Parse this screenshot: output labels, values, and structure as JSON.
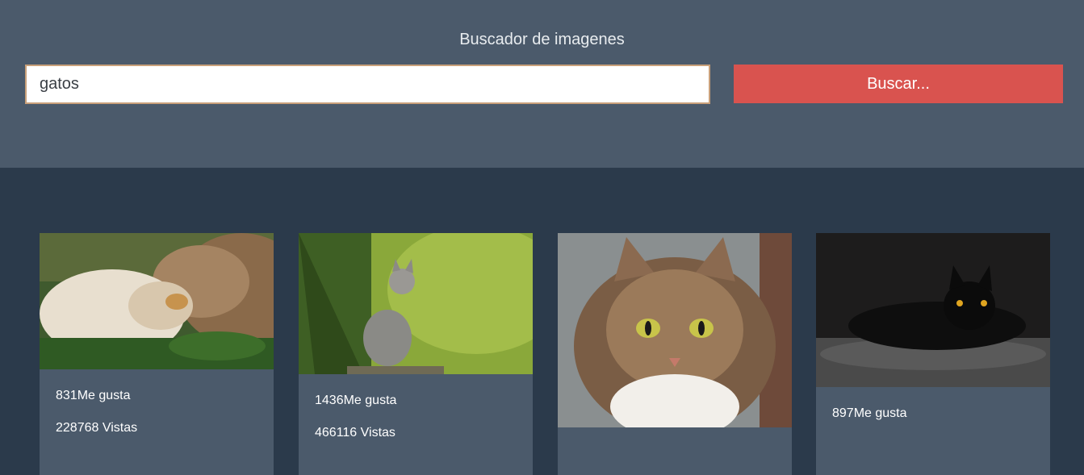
{
  "header": {
    "title": "Buscador de imagenes",
    "search_value": "gatos",
    "search_button_label": "Buscar..."
  },
  "results": [
    {
      "image": "cat-and-dog-photo",
      "likes": "831Me gusta",
      "views": "228768 Vistas"
    },
    {
      "image": "kitten-in-grass-photo",
      "likes": "1436Me gusta",
      "views": "466116 Vistas"
    },
    {
      "image": "tabby-cat-closeup-photo",
      "likes": "",
      "views": ""
    },
    {
      "image": "black-cat-photo",
      "likes": "897Me gusta",
      "views": ""
    }
  ],
  "colors": {
    "header_bg": "#4b5a6b",
    "page_bg": "#2b3a4b",
    "button": "#d9534f",
    "card_bg": "#4b5a6b"
  }
}
